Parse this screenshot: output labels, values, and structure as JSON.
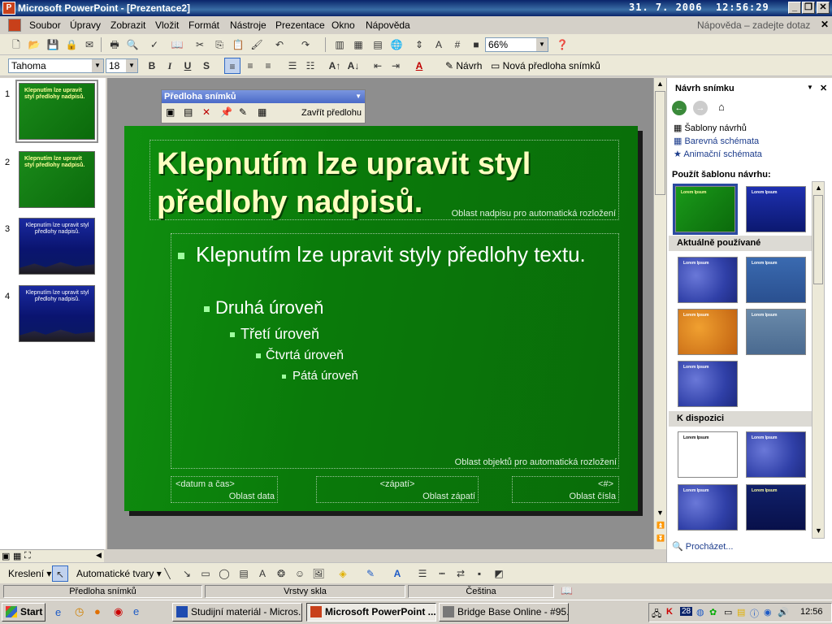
{
  "window": {
    "title": "Microsoft PowerPoint - [Prezentace2]",
    "date": "31. 7. 2006",
    "time": "12:56:29"
  },
  "menu": {
    "items": [
      "Soubor",
      "Úpravy",
      "Zobrazit",
      "Vložit",
      "Formát",
      "Nástroje",
      "Prezentace",
      "Okno",
      "Nápověda"
    ],
    "help_placeholder": "Nápověda – zadejte dotaz"
  },
  "toolbar": {
    "zoom": "66%",
    "font": "Tahoma",
    "size": "18",
    "design_label": "Návrh",
    "new_master_label": "Nová předloha snímků"
  },
  "slides_panel": {
    "numbers": [
      "1",
      "2",
      "3",
      "4"
    ],
    "thumb_texts": [
      "Klepnutím lze upravit styl předlohy nadpisů.",
      "Klepnutím lze upravit styl předlohy nadpisů.",
      "Klepnutím lze upravit styl předlohy nadpisů.",
      "Klepnutím lze upravit styl předlohy nadpisů."
    ]
  },
  "master_toolbar": {
    "caption": "Předloha snímků",
    "close_label": "Zavřít předlohu"
  },
  "slide": {
    "title": "Klepnutím lze upravit styl předlohy nadpisů.",
    "title_area_label": "Oblast nadpisu pro automatická rozložení",
    "bullets": [
      "Klepnutím lze upravit styly předlohy textu.",
      "Druhá úroveň",
      "Třetí úroveň",
      "Čtvrtá úroveň",
      "Pátá úroveň"
    ],
    "object_area_label": "Oblast objektů pro automatická rozložení",
    "footer": {
      "date_placeholder": "<datum a čas>",
      "date_label": "Oblast data",
      "footer_placeholder": "<zápatí>",
      "footer_label": "Oblast zápatí",
      "number_placeholder": "<#>",
      "number_label": "Oblast čísla"
    }
  },
  "task_pane": {
    "title": "Návrh snímku",
    "links": [
      "Šablony návrhů",
      "Barevná schémata",
      "Animační schémata"
    ],
    "apply_label": "Použít šablonu návrhu:",
    "section_current": "Aktuálně používané",
    "section_available": "K dispozici",
    "browse": "Procházet...",
    "template_text": "Lorem Ipsum"
  },
  "drawing_toolbar": {
    "draw_label": "Kreslení",
    "autoshapes_label": "Automatické tvary"
  },
  "status": {
    "view": "Předloha snímků",
    "layer": "Vrstvy skla",
    "language": "Čeština"
  },
  "taskbar": {
    "start": "Start",
    "tasks": [
      "Studijní materiál - Micros...",
      "Microsoft PowerPoint ...",
      "Bridge Base Online - #95..."
    ],
    "tray_time": "12:56",
    "tray_badge": "28"
  },
  "colors": {
    "slide_green": "#0a7a0a",
    "title_yellow": "#ffffc0",
    "accent_blue": "#0a246a"
  }
}
